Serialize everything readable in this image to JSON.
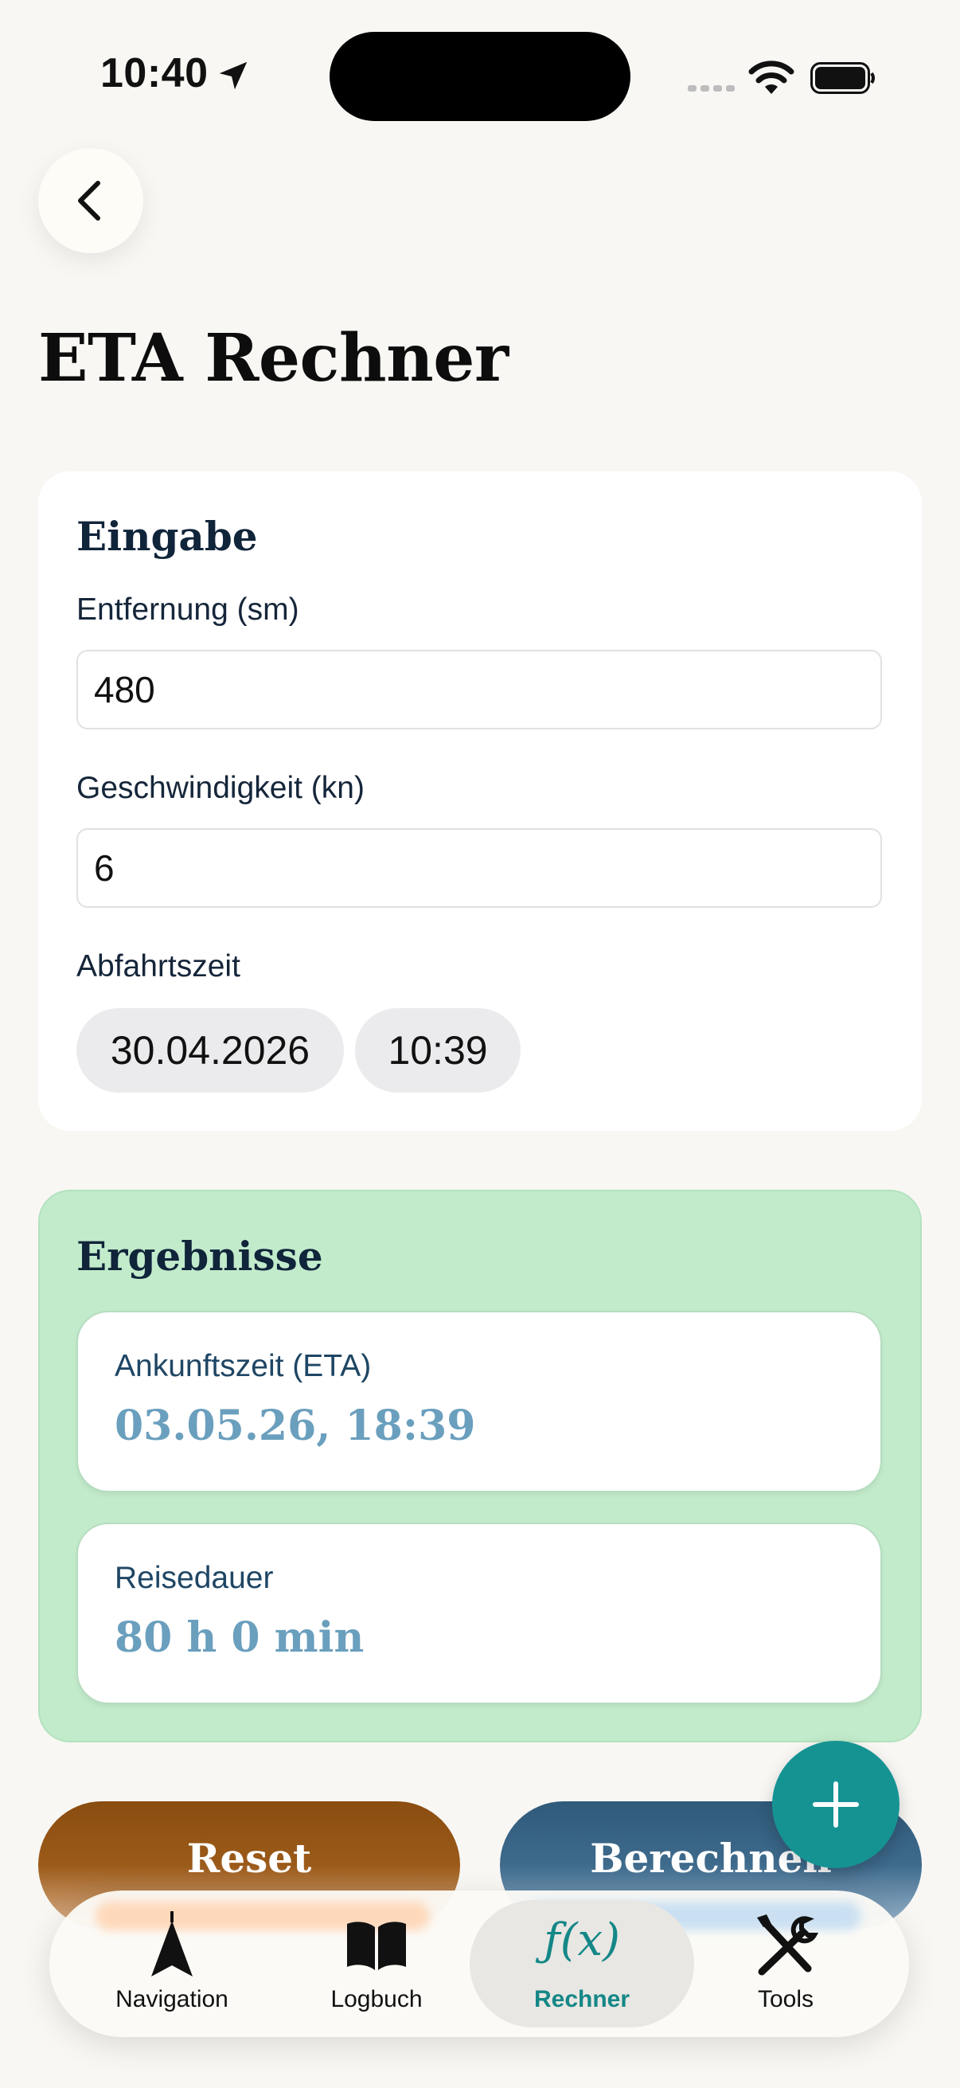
{
  "status_bar": {
    "time": "10:40"
  },
  "page": {
    "title": "ETA Rechner"
  },
  "input": {
    "section_title": "Eingabe",
    "distance_label": "Entfernung (sm)",
    "distance_value": "480",
    "speed_label": "Geschwindigkeit (kn)",
    "speed_value": "6",
    "departure_label": "Abfahrtszeit",
    "departure_date": "30.04.2026",
    "departure_time": "10:39"
  },
  "results": {
    "section_title": "Ergebnisse",
    "eta_label": "Ankunftszeit (ETA)",
    "eta_value": "03.05.26, 18:39",
    "duration_label": "Reisedauer",
    "duration_value": "80 h 0 min"
  },
  "actions": {
    "reset_label": "Reset",
    "calculate_label": "Berechnen"
  },
  "tab_bar": {
    "items": [
      {
        "label": "Navigation",
        "icon": "navigation-arrow-icon"
      },
      {
        "label": "Logbuch",
        "icon": "book-icon"
      },
      {
        "label": "Rechner",
        "icon": "function-icon",
        "active": true
      },
      {
        "label": "Tools",
        "icon": "tools-icon"
      }
    ]
  },
  "colors": {
    "accent": "#159393",
    "results_bg": "#c2ebcb",
    "result_value": "#6a9fbe"
  }
}
